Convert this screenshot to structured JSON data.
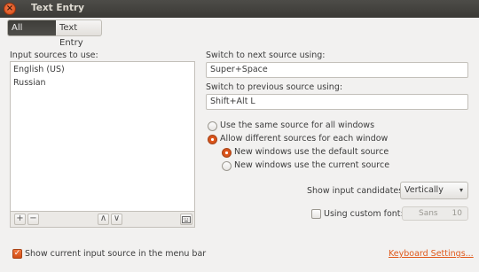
{
  "window": {
    "title": "Text Entry"
  },
  "breadcrumb": {
    "all_settings": "All Settings",
    "current": "Text Entry"
  },
  "sources": {
    "heading": "Input sources to use:",
    "items": [
      "English (US)",
      "Russian"
    ],
    "toolbar": {
      "add": "+",
      "remove": "−",
      "up": "∧",
      "down": "∨"
    }
  },
  "shortcuts": {
    "next_label": "Switch to next source using:",
    "next_value": "Super+Space",
    "prev_label": "Switch to previous source using:",
    "prev_value": "Shift+Alt L"
  },
  "options": {
    "same_source": "Use the same source for all windows",
    "different_sources": "Allow different sources for each window",
    "default_source": "New windows use the default source",
    "current_source": "New windows use the current source",
    "selected_scope": "different_sources",
    "selected_new_window": "default_source"
  },
  "candidates": {
    "label": "Show input candidates:",
    "value": "Vertically"
  },
  "custom_font": {
    "label": "Using custom font:",
    "checked": false,
    "font_name": "Sans",
    "font_size": "10"
  },
  "footer": {
    "show_in_menu": "Show current input source in the menu bar",
    "show_in_menu_checked": true,
    "keyboard_settings": "Keyboard Settings..."
  },
  "colors": {
    "accent": "#e05a1c",
    "titlebar": "#3c3b37"
  }
}
